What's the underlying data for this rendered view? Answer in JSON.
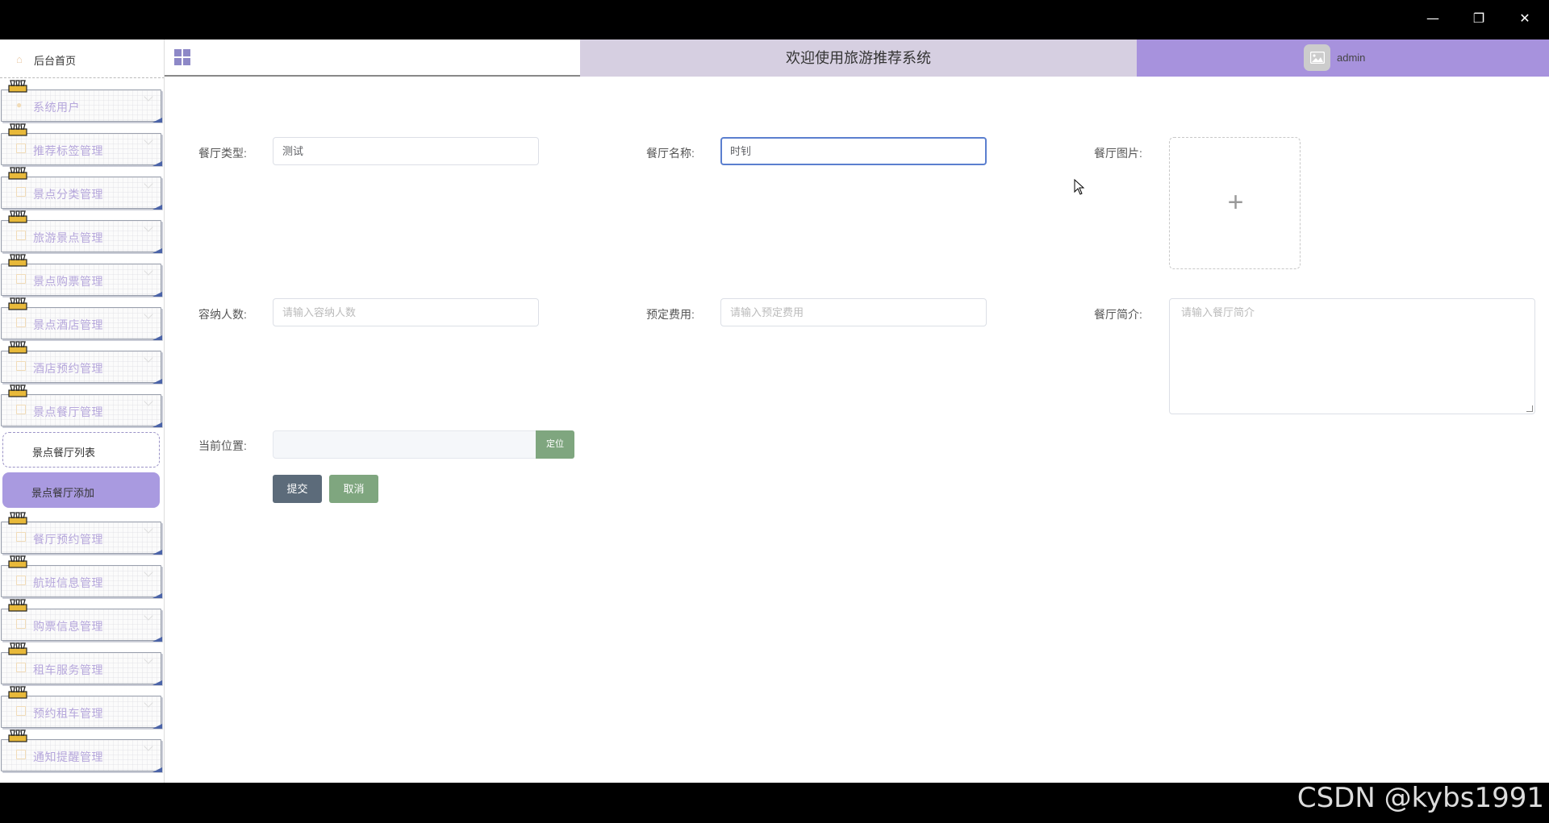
{
  "window": {
    "minimize_glyph": "—",
    "restore_glyph": "❐",
    "close_glyph": "✕"
  },
  "sidebar": {
    "home_label": "后台首页",
    "items": [
      {
        "label": "系统用户",
        "icon": "user-icon"
      },
      {
        "label": "推荐标签管理",
        "icon": "folder-icon"
      },
      {
        "label": "景点分类管理",
        "icon": "folder-icon"
      },
      {
        "label": "旅游景点管理",
        "icon": "folder-icon"
      },
      {
        "label": "景点购票管理",
        "icon": "folder-icon"
      },
      {
        "label": "景点酒店管理",
        "icon": "folder-icon"
      },
      {
        "label": "酒店预约管理",
        "icon": "folder-icon"
      },
      {
        "label": "景点餐厅管理",
        "icon": "folder-icon"
      }
    ],
    "submenu": {
      "list_label": "景点餐厅列表",
      "add_label": "景点餐厅添加"
    },
    "items_after": [
      {
        "label": "餐厅预约管理",
        "icon": "folder-icon"
      },
      {
        "label": "航班信息管理",
        "icon": "folder-icon"
      },
      {
        "label": "购票信息管理",
        "icon": "folder-icon"
      },
      {
        "label": "租车服务管理",
        "icon": "folder-icon"
      },
      {
        "label": "预约租车管理",
        "icon": "folder-icon"
      },
      {
        "label": "通知提醒管理",
        "icon": "folder-icon"
      }
    ]
  },
  "header": {
    "title": "欢迎使用旅游推荐系统",
    "username": "admin"
  },
  "form": {
    "type_label": "餐厅类型:",
    "type_value": "测试",
    "name_label": "餐厅名称:",
    "name_value": "时钊",
    "image_label": "餐厅图片:",
    "upload_plus": "+",
    "capacity_label": "容纳人数:",
    "capacity_placeholder": "请输入容纳人数",
    "fee_label": "预定费用:",
    "fee_placeholder": "请输入预定费用",
    "intro_label": "餐厅简介:",
    "intro_placeholder": "请输入餐厅简介",
    "location_label": "当前位置:",
    "locate_button": "定位",
    "submit_button": "提交",
    "cancel_button": "取消"
  },
  "colors": {
    "accent_purple": "#a792dd",
    "submit_bg": "#5c6b7a",
    "cancel_bg": "#7fa67f"
  },
  "watermark": "CSDN @kybs1991"
}
